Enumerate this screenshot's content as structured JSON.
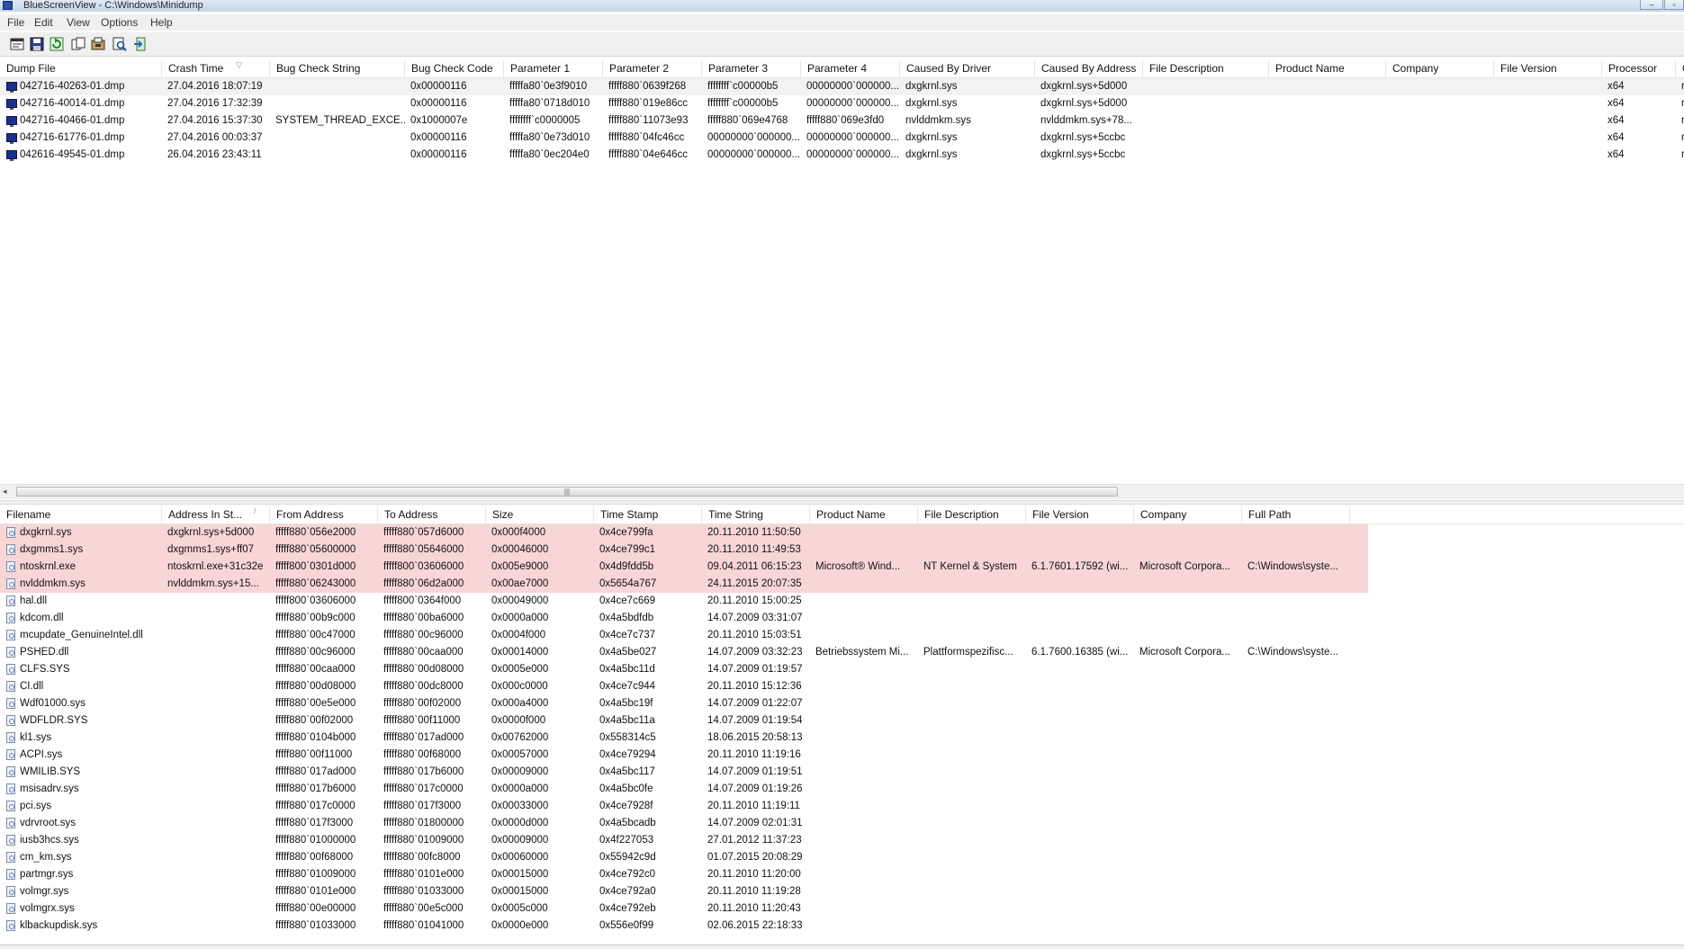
{
  "window": {
    "title": "BlueScreenView  -  C:\\Windows\\Minidump"
  },
  "menu": [
    "File",
    "Edit",
    "View",
    "Options",
    "Help"
  ],
  "toolbar_icons": [
    "properties-icon",
    "save-icon",
    "refresh-icon",
    "copy-icon",
    "html-report-icon",
    "find-icon",
    "exit-icon"
  ],
  "top_table": {
    "columns": [
      "Dump File",
      "Crash Time",
      "Bug Check String",
      "Bug Check Code",
      "Parameter 1",
      "Parameter 2",
      "Parameter 3",
      "Parameter 4",
      "Caused By Driver",
      "Caused By Address",
      "File Description",
      "Product Name",
      "Company",
      "File Version",
      "Processor",
      "C"
    ],
    "rows": [
      [
        "042716-40263-01.dmp",
        "27.04.2016 18:07:19",
        "",
        "0x00000116",
        "fffffa80`0e3f9010",
        "fffff880`0639f268",
        "ffffffff`c00000b5",
        "00000000`000000...",
        "dxgkrnl.sys",
        "dxgkrnl.sys+5d000",
        "",
        "",
        "",
        "",
        "x64",
        "r"
      ],
      [
        "042716-40014-01.dmp",
        "27.04.2016 17:32:39",
        "",
        "0x00000116",
        "fffffa80`0718d010",
        "fffff880`019e86cc",
        "ffffffff`c00000b5",
        "00000000`000000...",
        "dxgkrnl.sys",
        "dxgkrnl.sys+5d000",
        "",
        "",
        "",
        "",
        "x64",
        "r"
      ],
      [
        "042716-40466-01.dmp",
        "27.04.2016 15:37:30",
        "SYSTEM_THREAD_EXCE...",
        "0x1000007e",
        "ffffffff`c0000005",
        "fffff880`11073e93",
        "fffff880`069e4768",
        "fffff880`069e3fd0",
        "nvlddmkm.sys",
        "nvlddmkm.sys+78...",
        "",
        "",
        "",
        "",
        "x64",
        "r"
      ],
      [
        "042716-61776-01.dmp",
        "27.04.2016 00:03:37",
        "",
        "0x00000116",
        "fffffa80`0e73d010",
        "fffff880`04fc46cc",
        "00000000`000000...",
        "00000000`000000...",
        "dxgkrnl.sys",
        "dxgkrnl.sys+5ccbc",
        "",
        "",
        "",
        "",
        "x64",
        "r"
      ],
      [
        "042616-49545-01.dmp",
        "26.04.2016 23:43:11",
        "",
        "0x00000116",
        "fffffa80`0ec204e0",
        "fffff880`04e646cc",
        "00000000`000000...",
        "00000000`000000...",
        "dxgkrnl.sys",
        "dxgkrnl.sys+5ccbc",
        "",
        "",
        "",
        "",
        "x64",
        "r"
      ]
    ]
  },
  "bottom_table": {
    "columns": [
      "Filename",
      "Address In St...",
      "From Address",
      "To Address",
      "Size",
      "Time Stamp",
      "Time String",
      "Product Name",
      "File Description",
      "File Version",
      "Company",
      "Full Path"
    ],
    "rows": [
      [
        "dxgkrnl.sys",
        "dxgkrnl.sys+5d000",
        "fffff880`056e2000",
        "fffff880`057d6000",
        "0x000f4000",
        "0x4ce799fa",
        "20.11.2010 11:50:50",
        "",
        "",
        "",
        "",
        ""
      ],
      [
        "dxgmms1.sys",
        "dxgmms1.sys+ff07",
        "fffff880`05600000",
        "fffff880`05646000",
        "0x00046000",
        "0x4ce799c1",
        "20.11.2010 11:49:53",
        "",
        "",
        "",
        "",
        ""
      ],
      [
        "ntoskrnl.exe",
        "ntoskrnl.exe+31c32e",
        "fffff800`0301d000",
        "fffff800`03606000",
        "0x005e9000",
        "0x4d9fdd5b",
        "09.04.2011 06:15:23",
        "Microsoft® Wind...",
        "NT Kernel & System",
        "6.1.7601.17592 (wi...",
        "Microsoft Corpora...",
        "C:\\Windows\\syste..."
      ],
      [
        "nvlddmkm.sys",
        "nvlddmkm.sys+15...",
        "fffff880`06243000",
        "fffff880`06d2a000",
        "0x00ae7000",
        "0x5654a767",
        "24.11.2015 20:07:35",
        "",
        "",
        "",
        "",
        ""
      ],
      [
        "hal.dll",
        "",
        "fffff800`03606000",
        "fffff800`0364f000",
        "0x00049000",
        "0x4ce7c669",
        "20.11.2010 15:00:25",
        "",
        "",
        "",
        "",
        ""
      ],
      [
        "kdcom.dll",
        "",
        "fffff880`00b9c000",
        "fffff880`00ba6000",
        "0x0000a000",
        "0x4a5bdfdb",
        "14.07.2009 03:31:07",
        "",
        "",
        "",
        "",
        ""
      ],
      [
        "mcupdate_GenuineIntel.dll",
        "",
        "fffff880`00c47000",
        "fffff880`00c96000",
        "0x0004f000",
        "0x4ce7c737",
        "20.11.2010 15:03:51",
        "",
        "",
        "",
        "",
        ""
      ],
      [
        "PSHED.dll",
        "",
        "fffff880`00c96000",
        "fffff880`00caa000",
        "0x00014000",
        "0x4a5be027",
        "14.07.2009 03:32:23",
        "Betriebssystem Mi...",
        "Plattformspezifisc...",
        "6.1.7600.16385 (wi...",
        "Microsoft Corpora...",
        "C:\\Windows\\syste..."
      ],
      [
        "CLFS.SYS",
        "",
        "fffff880`00caa000",
        "fffff880`00d08000",
        "0x0005e000",
        "0x4a5bc11d",
        "14.07.2009 01:19:57",
        "",
        "",
        "",
        "",
        ""
      ],
      [
        "CI.dll",
        "",
        "fffff880`00d08000",
        "fffff880`00dc8000",
        "0x000c0000",
        "0x4ce7c944",
        "20.11.2010 15:12:36",
        "",
        "",
        "",
        "",
        ""
      ],
      [
        "Wdf01000.sys",
        "",
        "fffff880`00e5e000",
        "fffff880`00f02000",
        "0x000a4000",
        "0x4a5bc19f",
        "14.07.2009 01:22:07",
        "",
        "",
        "",
        "",
        ""
      ],
      [
        "WDFLDR.SYS",
        "",
        "fffff880`00f02000",
        "fffff880`00f11000",
        "0x0000f000",
        "0x4a5bc11a",
        "14.07.2009 01:19:54",
        "",
        "",
        "",
        "",
        ""
      ],
      [
        "kl1.sys",
        "",
        "fffff880`0104b000",
        "fffff880`017ad000",
        "0x00762000",
        "0x558314c5",
        "18.06.2015 20:58:13",
        "",
        "",
        "",
        "",
        ""
      ],
      [
        "ACPI.sys",
        "",
        "fffff880`00f11000",
        "fffff880`00f68000",
        "0x00057000",
        "0x4ce79294",
        "20.11.2010 11:19:16",
        "",
        "",
        "",
        "",
        ""
      ],
      [
        "WMILIB.SYS",
        "",
        "fffff880`017ad000",
        "fffff880`017b6000",
        "0x00009000",
        "0x4a5bc117",
        "14.07.2009 01:19:51",
        "",
        "",
        "",
        "",
        ""
      ],
      [
        "msisadrv.sys",
        "",
        "fffff880`017b6000",
        "fffff880`017c0000",
        "0x0000a000",
        "0x4a5bc0fe",
        "14.07.2009 01:19:26",
        "",
        "",
        "",
        "",
        ""
      ],
      [
        "pci.sys",
        "",
        "fffff880`017c0000",
        "fffff880`017f3000",
        "0x00033000",
        "0x4ce7928f",
        "20.11.2010 11:19:11",
        "",
        "",
        "",
        "",
        ""
      ],
      [
        "vdrvroot.sys",
        "",
        "fffff880`017f3000",
        "fffff880`01800000",
        "0x0000d000",
        "0x4a5bcadb",
        "14.07.2009 02:01:31",
        "",
        "",
        "",
        "",
        ""
      ],
      [
        "iusb3hcs.sys",
        "",
        "fffff880`01000000",
        "fffff880`01009000",
        "0x00009000",
        "0x4f227053",
        "27.01.2012 11:37:23",
        "",
        "",
        "",
        "",
        ""
      ],
      [
        "cm_km.sys",
        "",
        "fffff880`00f68000",
        "fffff880`00fc8000",
        "0x00060000",
        "0x55942c9d",
        "01.07.2015 20:08:29",
        "",
        "",
        "",
        "",
        ""
      ],
      [
        "partmgr.sys",
        "",
        "fffff880`01009000",
        "fffff880`0101e000",
        "0x00015000",
        "0x4ce792c0",
        "20.11.2010 11:20:00",
        "",
        "",
        "",
        "",
        ""
      ],
      [
        "volmgr.sys",
        "",
        "fffff880`0101e000",
        "fffff880`01033000",
        "0x00015000",
        "0x4ce792a0",
        "20.11.2010 11:19:28",
        "",
        "",
        "",
        "",
        ""
      ],
      [
        "volmgrx.sys",
        "",
        "fffff880`00e00000",
        "fffff880`00e5c000",
        "0x0005c000",
        "0x4ce792eb",
        "20.11.2010 11:20:43",
        "",
        "",
        "",
        "",
        ""
      ],
      [
        "klbackupdisk.sys",
        "",
        "fffff880`01033000",
        "fffff880`01041000",
        "0x0000e000",
        "0x556e0f99",
        "02.06.2015 22:18:33",
        "",
        "",
        "",
        "",
        ""
      ]
    ],
    "highlight_color": "#f9d6d6"
  }
}
